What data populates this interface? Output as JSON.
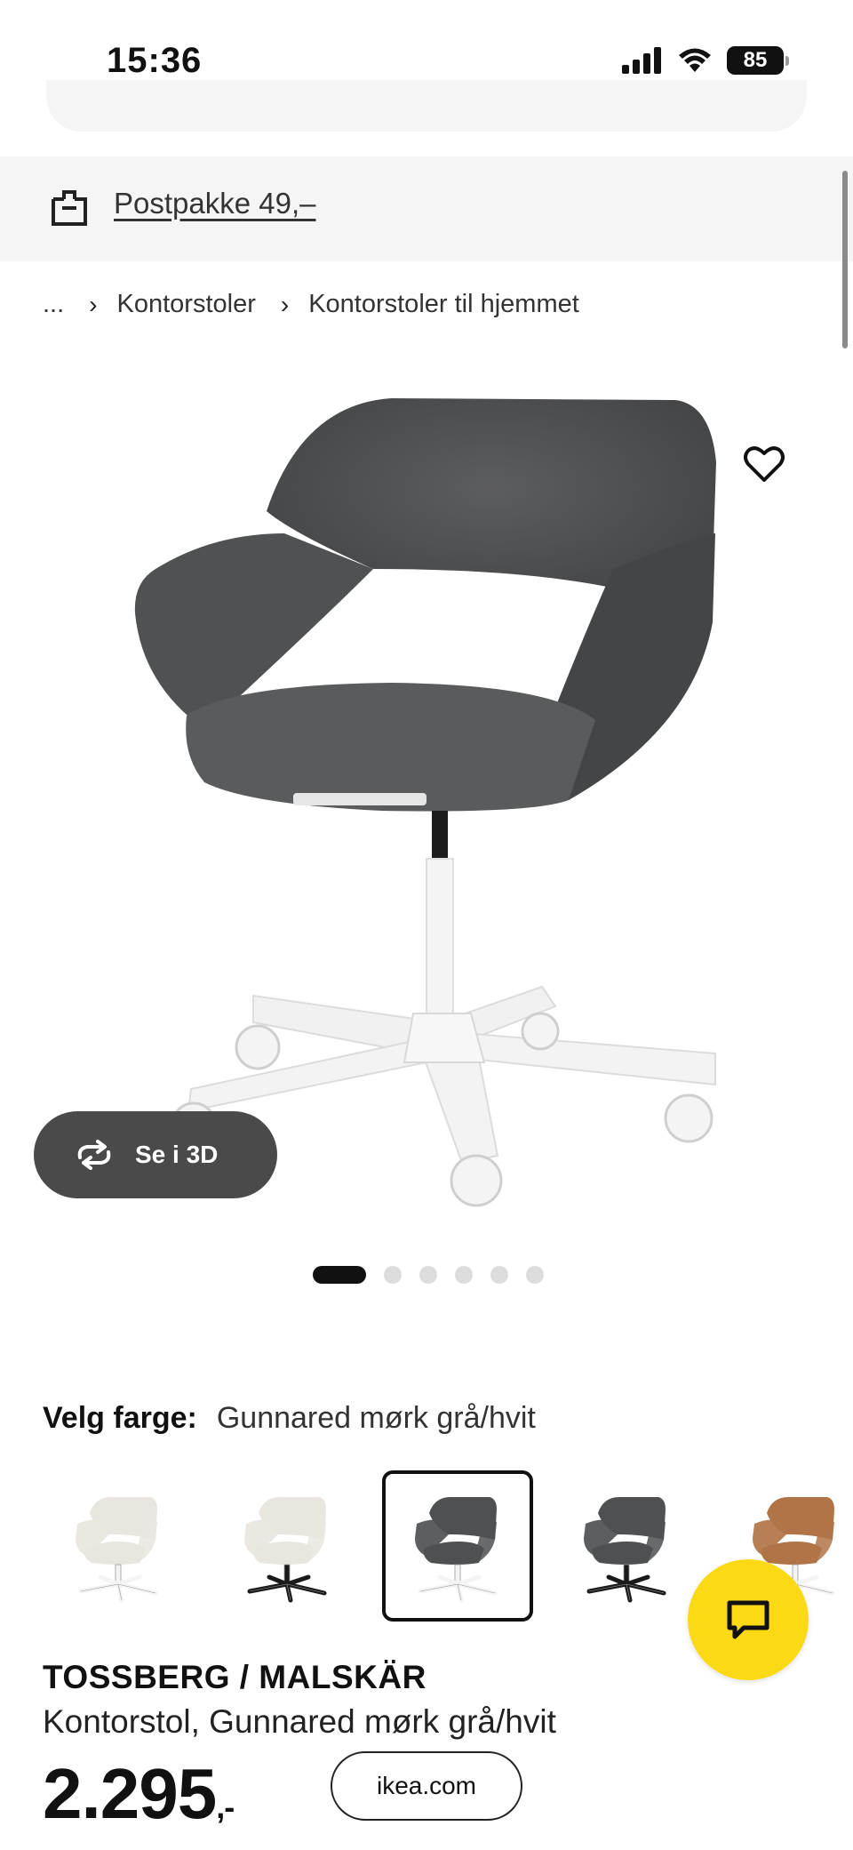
{
  "status_bar": {
    "time": "15:36",
    "battery_level": "85"
  },
  "shipping": {
    "label": "Postpakke 49,–",
    "icon": "package-box-icon"
  },
  "breadcrumb": {
    "ellipsis": "...",
    "items": [
      "Kontorstoler",
      "Kontorstoler til hjemmet"
    ]
  },
  "gallery": {
    "view3d_label": "Se i 3D",
    "favorite_icon": "heart-icon",
    "image_count": 6,
    "active_index": 0
  },
  "color_chooser": {
    "label": "Velg farge:",
    "selected": "Gunnared mørk grå/hvit",
    "swatches": [
      {
        "seat_color": "#e9e6df",
        "base_color": "#f4f4f4",
        "selected": false
      },
      {
        "seat_color": "#e9e6df",
        "base_color": "#1a1a1a",
        "selected": false
      },
      {
        "seat_color": "#4f5052",
        "base_color": "#f4f4f4",
        "selected": true
      },
      {
        "seat_color": "#4f5052",
        "base_color": "#1a1a1a",
        "selected": false
      },
      {
        "seat_color": "#b07446",
        "base_color": "#f4f4f4",
        "selected": false
      }
    ]
  },
  "product": {
    "name": "TOSSBERG / MALSKÄR",
    "description": "Kontorstol, Gunnared mørk grå/hvit",
    "price": "2.295",
    "price_suffix": ",-"
  },
  "browser": {
    "url": "ikea.com"
  },
  "colors": {
    "chat_yellow": "#fbd914",
    "chair_fabric": "#4f5052",
    "button_dark": "#4a4a4a"
  }
}
